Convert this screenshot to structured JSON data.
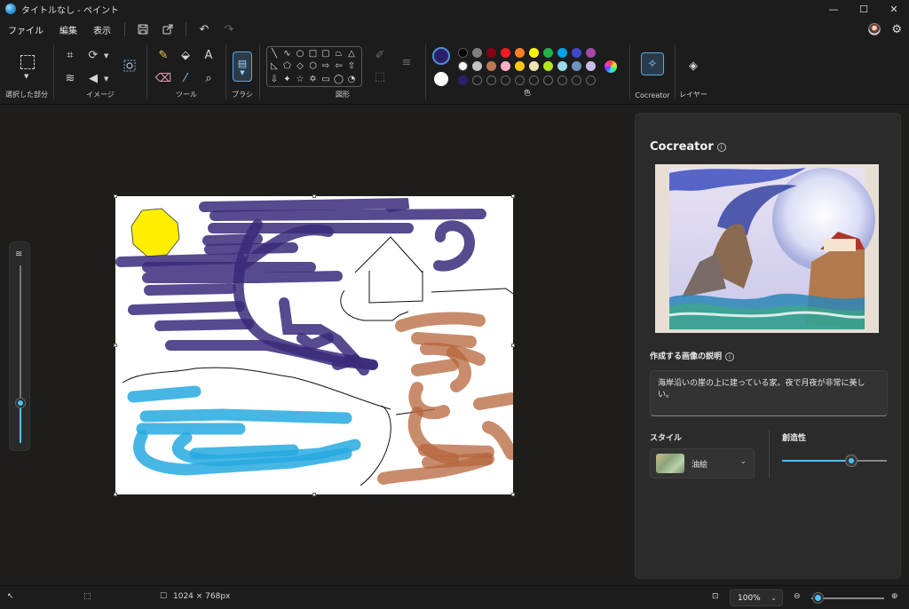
{
  "window": {
    "title": "タイトルなし - ペイント",
    "minimize": "—",
    "maximize": "☐",
    "close": "✕"
  },
  "menu": {
    "file": "ファイル",
    "edit": "編集",
    "view": "表示"
  },
  "ribbon": {
    "groups": {
      "selection": "選択した部分",
      "image": "イメージ",
      "tools": "ツール",
      "brush": "ブラシ",
      "shapes": "図形",
      "colors": "色",
      "cocreator": "Cocreator",
      "layers": "レイヤー"
    },
    "colors": {
      "primary": "#2b1f6b",
      "secondary": "#ffffff",
      "row1": [
        "#000000",
        "#7f7f7f",
        "#880015",
        "#ed1c24",
        "#ff7f27",
        "#fff200",
        "#22b14c",
        "#00a2e8",
        "#3f48cc",
        "#a349a4"
      ],
      "row2": [
        "#ffffff",
        "#c3c3c3",
        "#b97a57",
        "#ffaec9",
        "#ffc90e",
        "#efe4b0",
        "#b5e61d",
        "#99d9ea",
        "#7092be",
        "#c8bfe7"
      ],
      "row3_first": "#2b1f6b"
    }
  },
  "canvas": {
    "size_label": "1024 × 768px"
  },
  "cocreator": {
    "title": "Cocreator",
    "prompt_label": "作成する画像の説明",
    "prompt_text": "海岸沿いの崖の上に建っている家。夜で月夜が非常に美しい。",
    "style_label": "スタイル",
    "style_value": "油絵",
    "creativity_label": "創造性",
    "creativity_level": 0.66
  },
  "status": {
    "zoom": "100%",
    "zoom_level": 0.08
  }
}
